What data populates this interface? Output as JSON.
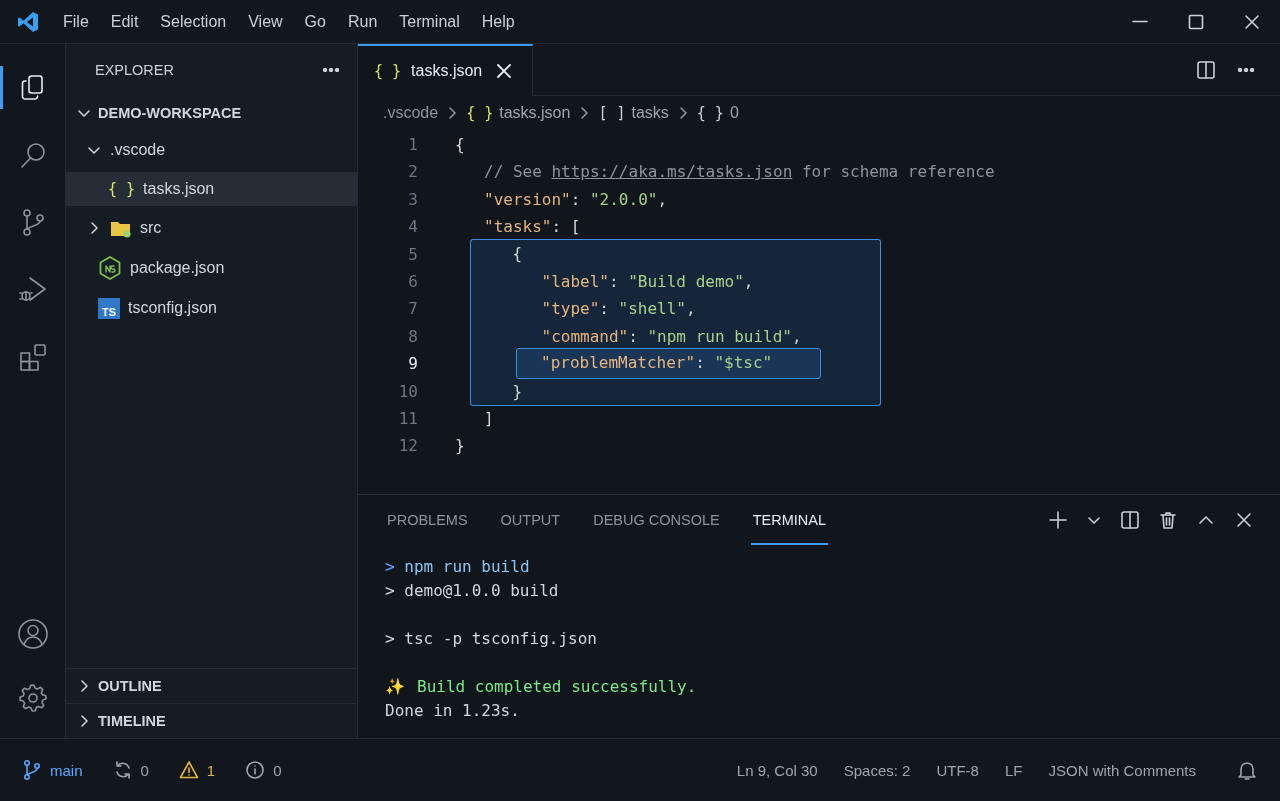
{
  "title_bar": {
    "menu": [
      "File",
      "Edit",
      "Selection",
      "View",
      "Go",
      "Run",
      "Terminal",
      "Help"
    ]
  },
  "activity_bar": {
    "items": [
      {
        "kind": "files",
        "selected": true
      },
      {
        "kind": "search",
        "selected": false
      },
      {
        "kind": "source-control",
        "selected": false
      },
      {
        "kind": "run-debug",
        "selected": false
      },
      {
        "kind": "extensions",
        "selected": false
      }
    ],
    "bottom": [
      {
        "kind": "account"
      },
      {
        "kind": "settings"
      }
    ]
  },
  "sidebar": {
    "title": "EXPLORER",
    "workspace": {
      "label": "DEMO-WORKSPACE",
      "expanded": true
    },
    "tree": [
      {
        "label": ".vscode",
        "kind": "folder",
        "expanded": true,
        "selected": false,
        "children": [
          {
            "label": "tasks.json",
            "kind": "json",
            "icon": "{ }",
            "selected": true
          }
        ]
      },
      {
        "label": "src",
        "kind": "folder",
        "expanded": false,
        "selected": false
      },
      {
        "label": "package.json",
        "kind": "node",
        "selected": false
      },
      {
        "label": "tsconfig.json",
        "kind": "ts",
        "icon": "TS",
        "selected": false
      }
    ],
    "sections": [
      {
        "label": "OUTLINE",
        "expanded": false
      },
      {
        "label": "TIMELINE",
        "expanded": false
      }
    ]
  },
  "editor": {
    "tabs": [
      {
        "label": "tasks.json",
        "icon": "{ }",
        "selected": true
      }
    ],
    "breadcrumbs": [
      {
        "label": ".vscode",
        "kind": "folder"
      },
      {
        "label": "tasks.json",
        "kind": "file",
        "icon": "{ }"
      },
      {
        "label": "tasks",
        "kind": "array",
        "icon": "[ ]"
      },
      {
        "label": "0",
        "kind": "object",
        "icon": "{ }"
      }
    ],
    "lines": [
      {
        "number": "1",
        "highlighted": false,
        "current": false,
        "tokens": [
          {
            "kind": "punct",
            "text": "{"
          }
        ],
        "children": [
          {
            "number": "2",
            "highlighted": false,
            "current": false,
            "tokens": [
              {
                "kind": "comment",
                "text": "// See "
              },
              {
                "kind": "link",
                "text": "https://aka.ms/tasks.json"
              },
              {
                "kind": "comment",
                "text": " for schema reference"
              }
            ]
          },
          {
            "number": "3",
            "highlighted": false,
            "current": false,
            "tokens": [
              {
                "kind": "key",
                "text": "\"version\""
              },
              {
                "kind": "punct",
                "text": ": "
              },
              {
                "kind": "string",
                "text": "\"2.0.0\""
              },
              {
                "kind": "punct",
                "text": ","
              }
            ]
          },
          {
            "number": "4",
            "highlighted": false,
            "current": false,
            "tokens": [
              {
                "kind": "key",
                "text": "\"tasks\""
              },
              {
                "kind": "punct",
                "text": ": ["
              }
            ],
            "children": [
              {
                "number": "5",
                "highlighted": true,
                "current": false,
                "tokens": [
                  {
                    "kind": "punct",
                    "text": "{"
                  }
                ],
                "children": [
                  {
                    "number": "6",
                    "highlighted": true,
                    "current": false,
                    "tokens": [
                      {
                        "kind": "key",
                        "text": "\"label\""
                      },
                      {
                        "kind": "punct",
                        "text": ": "
                      },
                      {
                        "kind": "string",
                        "text": "\"Build demo\""
                      },
                      {
                        "kind": "punct",
                        "text": ","
                      }
                    ]
                  },
                  {
                    "number": "7",
                    "highlighted": true,
                    "current": false,
                    "tokens": [
                      {
                        "kind": "key",
                        "text": "\"type\""
                      },
                      {
                        "kind": "punct",
                        "text": ": "
                      },
                      {
                        "kind": "string",
                        "text": "\"shell\""
                      },
                      {
                        "kind": "punct",
                        "text": ","
                      }
                    ]
                  },
                  {
                    "number": "8",
                    "highlighted": true,
                    "current": false,
                    "tokens": [
                      {
                        "kind": "key",
                        "text": "\"command\""
                      },
                      {
                        "kind": "punct",
                        "text": ": "
                      },
                      {
                        "kind": "string",
                        "text": "\"npm run build\""
                      },
                      {
                        "kind": "punct",
                        "text": ","
                      }
                    ]
                  },
                  {
                    "number": "9",
                    "highlighted": true,
                    "current": true,
                    "tokens": [
                      {
                        "kind": "key",
                        "text": "\"problemMatcher\""
                      },
                      {
                        "kind": "punct",
                        "text": ": "
                      },
                      {
                        "kind": "string",
                        "text": "\"$tsc\""
                      }
                    ]
                  }
                ]
              },
              {
                "number": "10",
                "highlighted": true,
                "current": false,
                "tokens": [
                  {
                    "kind": "punct",
                    "text": "}"
                  }
                ]
              }
            ]
          },
          {
            "number": "11",
            "highlighted": false,
            "current": false,
            "tokens": [
              {
                "kind": "punct",
                "text": "]"
              }
            ]
          }
        ]
      },
      {
        "number": "12",
        "highlighted": false,
        "current": false,
        "tokens": [
          {
            "kind": "punct",
            "text": "}"
          }
        ]
      }
    ]
  },
  "panel": {
    "tabs": [
      {
        "label": "PROBLEMS",
        "selected": false
      },
      {
        "label": "OUTPUT",
        "selected": false
      },
      {
        "label": "DEBUG CONSOLE",
        "selected": false
      },
      {
        "label": "TERMINAL",
        "selected": true
      }
    ],
    "terminal": [
      {
        "kind": "command",
        "prompt": ">",
        "text": "npm run build"
      },
      {
        "kind": "output",
        "text": "> demo@1.0.0 build"
      },
      {
        "kind": "blank"
      },
      {
        "kind": "output",
        "text": "> tsc -p tsconfig.json"
      },
      {
        "kind": "blank"
      },
      {
        "kind": "success",
        "icon": "✨",
        "text": "Build completed successfully."
      },
      {
        "kind": "output",
        "text": "Done in 1.23s."
      }
    ]
  },
  "status_bar": {
    "branch": "main",
    "sync": "0",
    "warnings": "1",
    "info": "0",
    "right": [
      "Ln 9, Col 30",
      "Spaces: 2",
      "UTF-8",
      "LF",
      "JSON with Comments"
    ]
  }
}
